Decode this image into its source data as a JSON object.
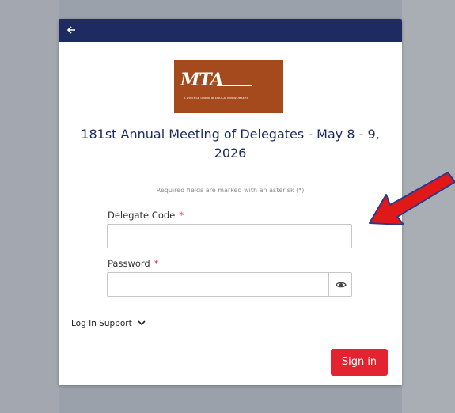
{
  "header": {
    "back_icon": "arrow-left-icon"
  },
  "logo": {
    "text": "MTA",
    "tagline": "A DIVERSE UNION of EDUCATION WORKERS"
  },
  "title": "181st Annual Meeting of Delegates - May 8 - 9, 2026",
  "required_note": "Required fields are marked with an asterisk (*)",
  "fields": {
    "delegate_code": {
      "label": "Delegate Code",
      "required_mark": "*",
      "value": ""
    },
    "password": {
      "label": "Password",
      "required_mark": "*",
      "value": "",
      "toggle_icon": "eye-icon"
    }
  },
  "support": {
    "label": "Log In Support",
    "icon": "chevron-down-icon"
  },
  "sign_in_label": "Sign in",
  "colors": {
    "header": "#1e2b62",
    "accent": "#e3232f",
    "logo_bg": "#a54a1d",
    "arrow": "#e01818"
  }
}
